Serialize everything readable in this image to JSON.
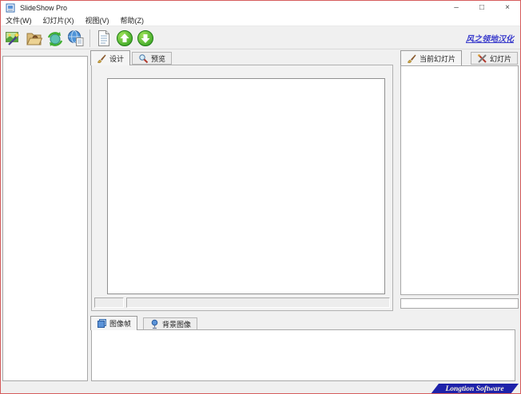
{
  "window": {
    "title": "SlideShow Pro",
    "controls": {
      "minimize": "–",
      "maximize": "□",
      "close": "×"
    }
  },
  "menu": {
    "items": [
      {
        "label": "文件(W)"
      },
      {
        "label": "幻灯片(X)"
      },
      {
        "label": "视图(V)"
      },
      {
        "label": "帮助(Z)"
      }
    ]
  },
  "toolbar": {
    "buttons": [
      {
        "name": "new-slideshow",
        "icon": "image-wand-icon"
      },
      {
        "name": "open-project",
        "icon": "open-folder-icon"
      },
      {
        "name": "publish-slideshow",
        "icon": "globe-refresh-icon"
      },
      {
        "name": "export-web",
        "icon": "globe-page-icon"
      },
      {
        "name": "preview-document",
        "icon": "document-icon"
      },
      {
        "name": "move-up",
        "icon": "green-up-arrow-icon"
      },
      {
        "name": "move-down",
        "icon": "green-down-arrow-icon"
      }
    ],
    "link_label": "风之领地汉化"
  },
  "center": {
    "tabs": [
      {
        "label": "设计",
        "active": true
      },
      {
        "label": "预览",
        "active": false
      }
    ]
  },
  "right": {
    "tabs": [
      {
        "label": "当前幻灯片",
        "active": true
      },
      {
        "label": "幻灯片",
        "active": false
      }
    ]
  },
  "bottom": {
    "tabs": [
      {
        "label": "图像帧",
        "active": true
      },
      {
        "label": "背景图像",
        "active": false
      }
    ]
  },
  "footer": {
    "brand": "Longtion Software"
  },
  "colors": {
    "window_border": "#d65c5c",
    "panel_bg": "#f0f0f0",
    "link_blue": "#3a3ccc",
    "badge_blue": "#1e22aa"
  }
}
